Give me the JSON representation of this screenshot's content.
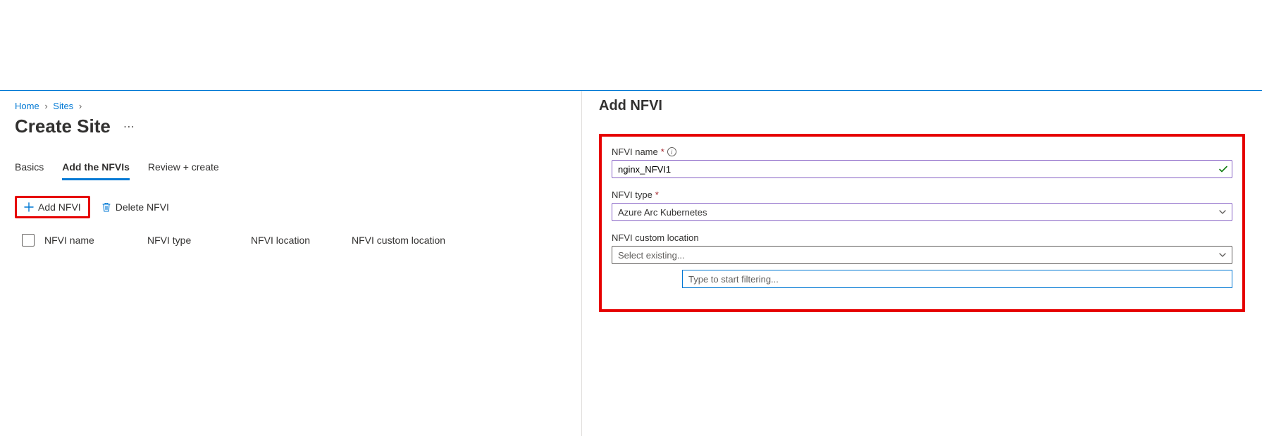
{
  "breadcrumb": {
    "home": "Home",
    "sites": "Sites"
  },
  "title": "Create Site",
  "tabs": {
    "basics": "Basics",
    "add_nfvis": "Add the NFVIs",
    "review": "Review + create"
  },
  "toolbar": {
    "add": "Add NFVI",
    "delete": "Delete NFVI"
  },
  "table": {
    "col_name": "NFVI name",
    "col_type": "NFVI type",
    "col_location": "NFVI location",
    "col_custom": "NFVI custom location"
  },
  "panel": {
    "title": "Add NFVI",
    "name_label": "NFVI name",
    "name_value": "nginx_NFVI1",
    "type_label": "NFVI type",
    "type_value": "Azure Arc Kubernetes",
    "custom_label": "NFVI custom location",
    "custom_value": "Select existing...",
    "filter_placeholder": "Type to start filtering..."
  }
}
